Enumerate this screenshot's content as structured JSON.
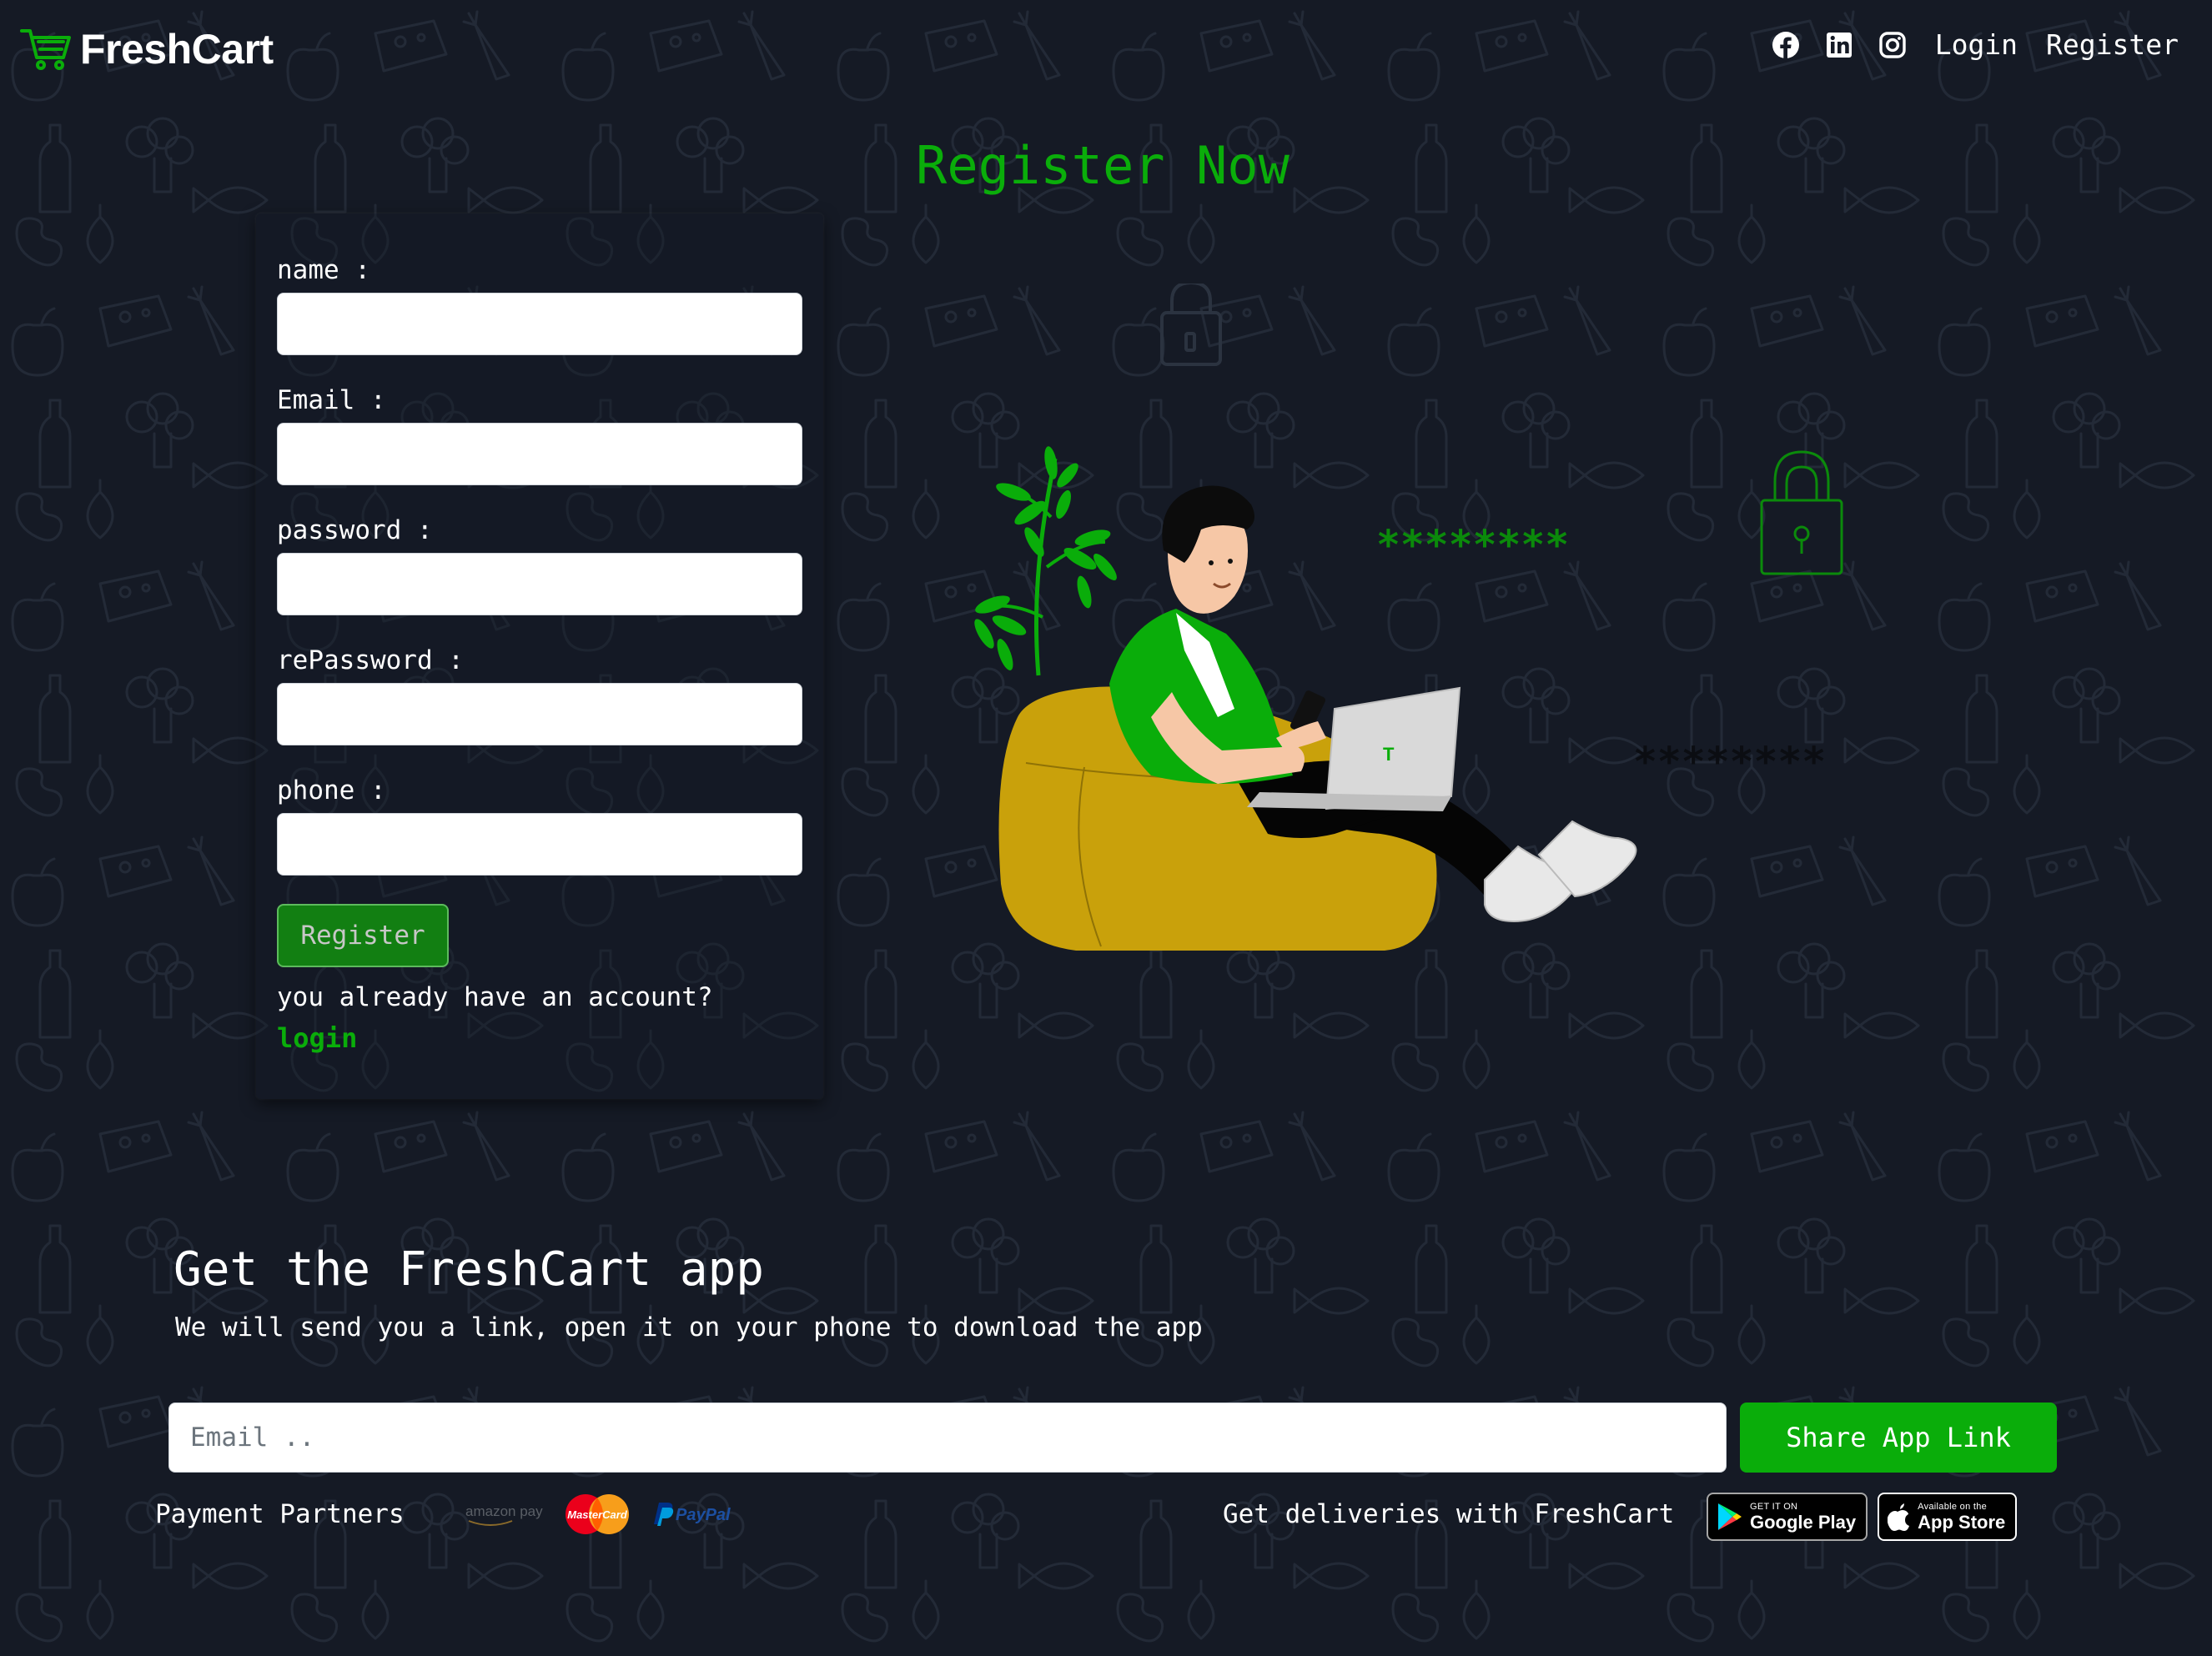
{
  "brand": {
    "name": "FreshCart",
    "accent_color": "#0aad0a",
    "background_color": "#151a25"
  },
  "nav": {
    "social_icons": [
      "facebook-icon",
      "linkedin-icon",
      "instagram-icon"
    ],
    "login_label": "Login",
    "register_label": "Register"
  },
  "page": {
    "title": "Register Now"
  },
  "form": {
    "fields": [
      {
        "label": "name :",
        "value": ""
      },
      {
        "label": "Email :",
        "value": ""
      },
      {
        "label": "password :",
        "value": ""
      },
      {
        "label": "rePassword :",
        "value": ""
      },
      {
        "label": "phone :",
        "value": ""
      }
    ],
    "submit_label": "Register",
    "have_account_text": "you already have an account?",
    "login_link": "login"
  },
  "illustration": {
    "password_mask_1": "********",
    "password_mask_2": "********",
    "laptop_logo": "T"
  },
  "app_section": {
    "title": "Get the FreshCart app",
    "subtitle": "We will send you a link, open it on your phone to download the app",
    "email_placeholder": "Email ..",
    "share_button": "Share App Link",
    "payment_label": "Payment Partners",
    "payment_partners": [
      "amazon pay",
      "MasterCard",
      "PayPal"
    ],
    "deliveries_label": "Get deliveries with FreshCart",
    "google_play": {
      "small": "GET IT ON",
      "big": "Google Play"
    },
    "app_store": {
      "small": "Available on the",
      "big": "App Store"
    }
  }
}
